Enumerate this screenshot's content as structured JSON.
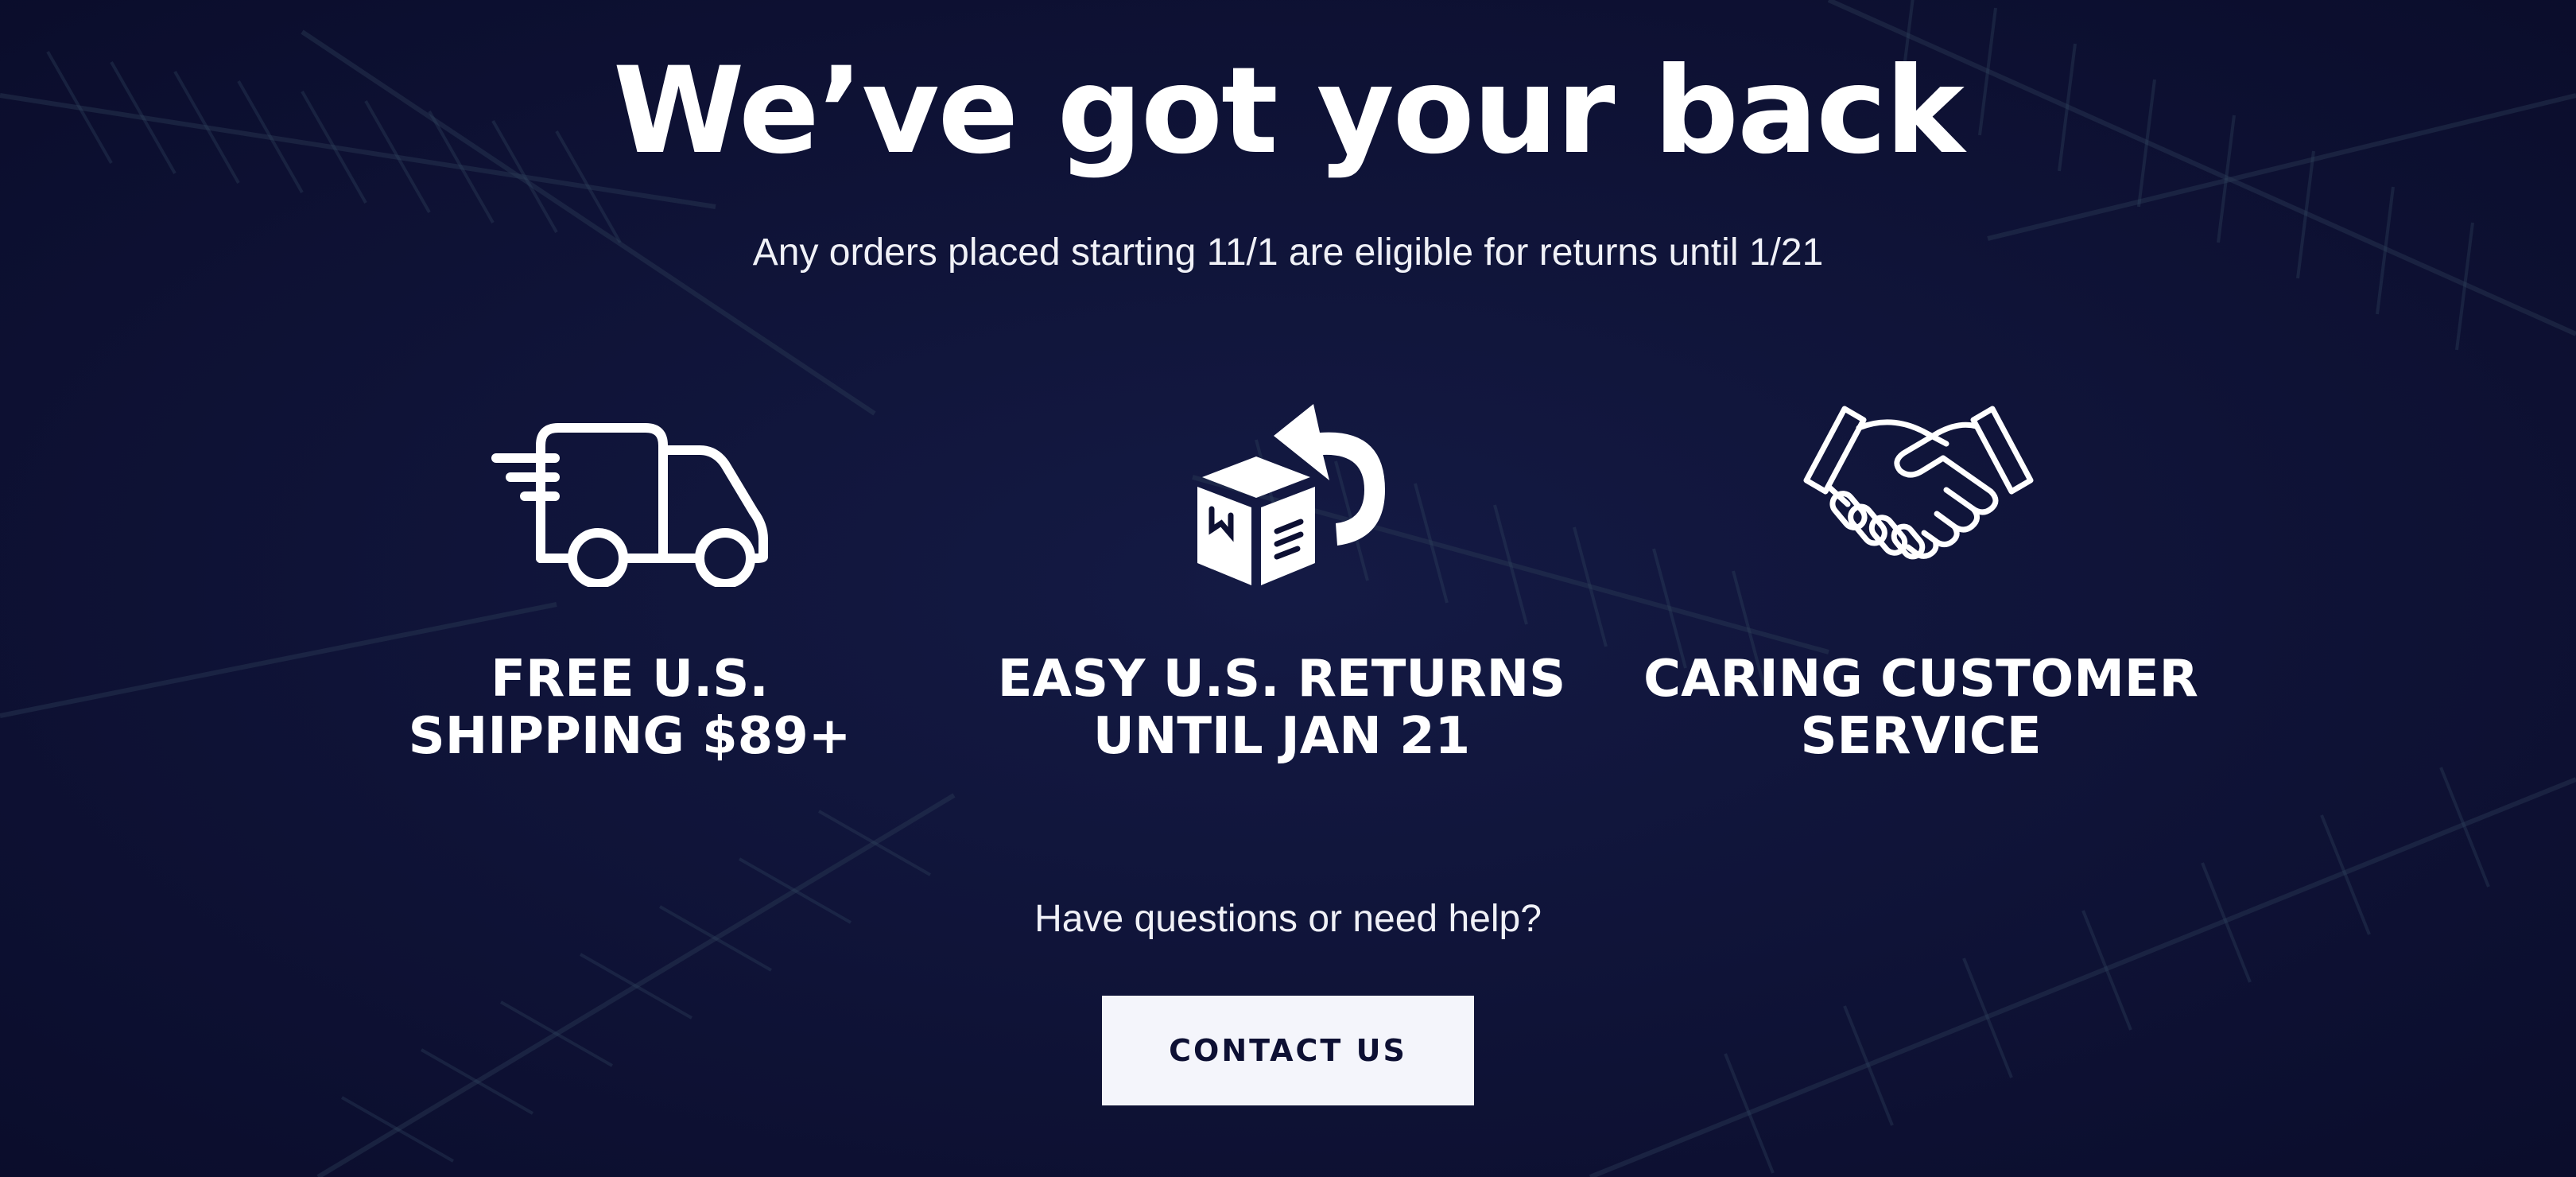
{
  "hero": {
    "headline": "We’ve got your back",
    "subheadline": "Any orders placed starting 11/1 are eligible for returns until 1/21"
  },
  "features": [
    {
      "icon": "delivery-truck-icon",
      "line1": "FREE U.S.",
      "line2": "SHIPPING $89+"
    },
    {
      "icon": "package-return-icon",
      "line1": "EASY U.S. RETURNS",
      "line2": "UNTIL JAN 21"
    },
    {
      "icon": "handshake-icon",
      "line1": "CARING CUSTOMER",
      "line2": "SERVICE"
    }
  ],
  "help": {
    "text": "Have questions or need help?",
    "button_label": "CONTACT US"
  },
  "colors": {
    "background": "#0d1033",
    "text": "#ffffff",
    "button_bg": "#f4f5fb",
    "button_text": "#0d1033"
  }
}
